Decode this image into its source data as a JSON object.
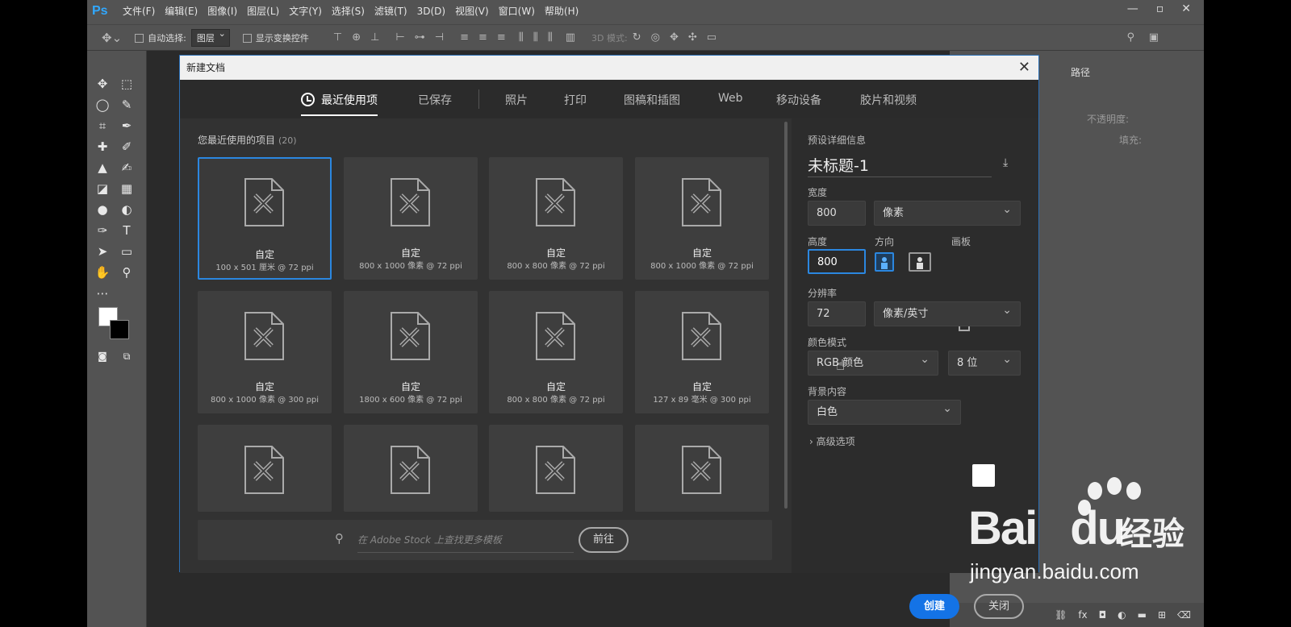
{
  "app": {
    "logo": "Ps"
  },
  "menu": [
    "文件(F)",
    "编辑(E)",
    "图像(I)",
    "图层(L)",
    "文字(Y)",
    "选择(S)",
    "滤镜(T)",
    "3D(D)",
    "视图(V)",
    "窗口(W)",
    "帮助(H)"
  ],
  "window_controls": [
    "—",
    "▫",
    "✕"
  ],
  "options_bar": {
    "auto_select_label": "自动选择:",
    "auto_select_value": "图层",
    "show_transform_label": "显示变换控件",
    "mode_3d_label": "3D 模式:"
  },
  "right_panel": {
    "tab": "路径",
    "opacity_label": "不透明度:",
    "fill_label": "填充:"
  },
  "dialog": {
    "title": "新建文档",
    "close_glyph": "✕",
    "tabs": [
      "最近使用项",
      "已保存",
      "照片",
      "打印",
      "图稿和插图",
      "Web",
      "移动设备",
      "胶片和视频"
    ],
    "active_tab": "最近使用项",
    "recent": {
      "title": "您最近使用的项目",
      "count": "(20)",
      "items": [
        {
          "name": "自定",
          "info": "100 x 501 厘米 @ 72 ppi"
        },
        {
          "name": "自定",
          "info": "800 x 1000 像素 @ 72 ppi"
        },
        {
          "name": "自定",
          "info": "800 x 800 像素 @ 72 ppi"
        },
        {
          "name": "自定",
          "info": "800 x 1000 像素 @ 72 ppi"
        },
        {
          "name": "自定",
          "info": "800 x 1000 像素 @ 300 ppi"
        },
        {
          "name": "自定",
          "info": "1800 x 600 像素 @ 72 ppi"
        },
        {
          "name": "自定",
          "info": "800 x 800 像素 @ 72 ppi"
        },
        {
          "name": "自定",
          "info": "127 x 89 毫米 @ 300 ppi"
        }
      ]
    },
    "stock": {
      "placeholder": "在 Adobe Stock 上查找更多模板",
      "go_label": "前往"
    },
    "preset": {
      "section_title": "预设详细信息",
      "doc_name": "未标题-1",
      "width_label": "宽度",
      "width_value": "800",
      "width_unit": "像素",
      "height_label": "高度",
      "height_value": "800",
      "orientation_label": "方向",
      "artboard_label": "画板",
      "resolution_label": "分辨率",
      "resolution_value": "72",
      "resolution_unit": "像素/英寸",
      "color_mode_label": "颜色模式",
      "color_mode_value": "RGB 颜色",
      "bit_depth": "8 位",
      "background_label": "背景内容",
      "background_value": "白色",
      "background_color": "#ffffff",
      "advanced_label": "高级选项",
      "create_label": "创建",
      "close_label": "关闭"
    }
  },
  "watermark": {
    "brand": "Bai",
    "brand2": "du",
    "cn": "经验",
    "url": "jingyan.baidu.com"
  },
  "colors": {
    "accent": "#1473e6",
    "selection": "#2b87e0",
    "ps_blue": "#31a8ff"
  }
}
